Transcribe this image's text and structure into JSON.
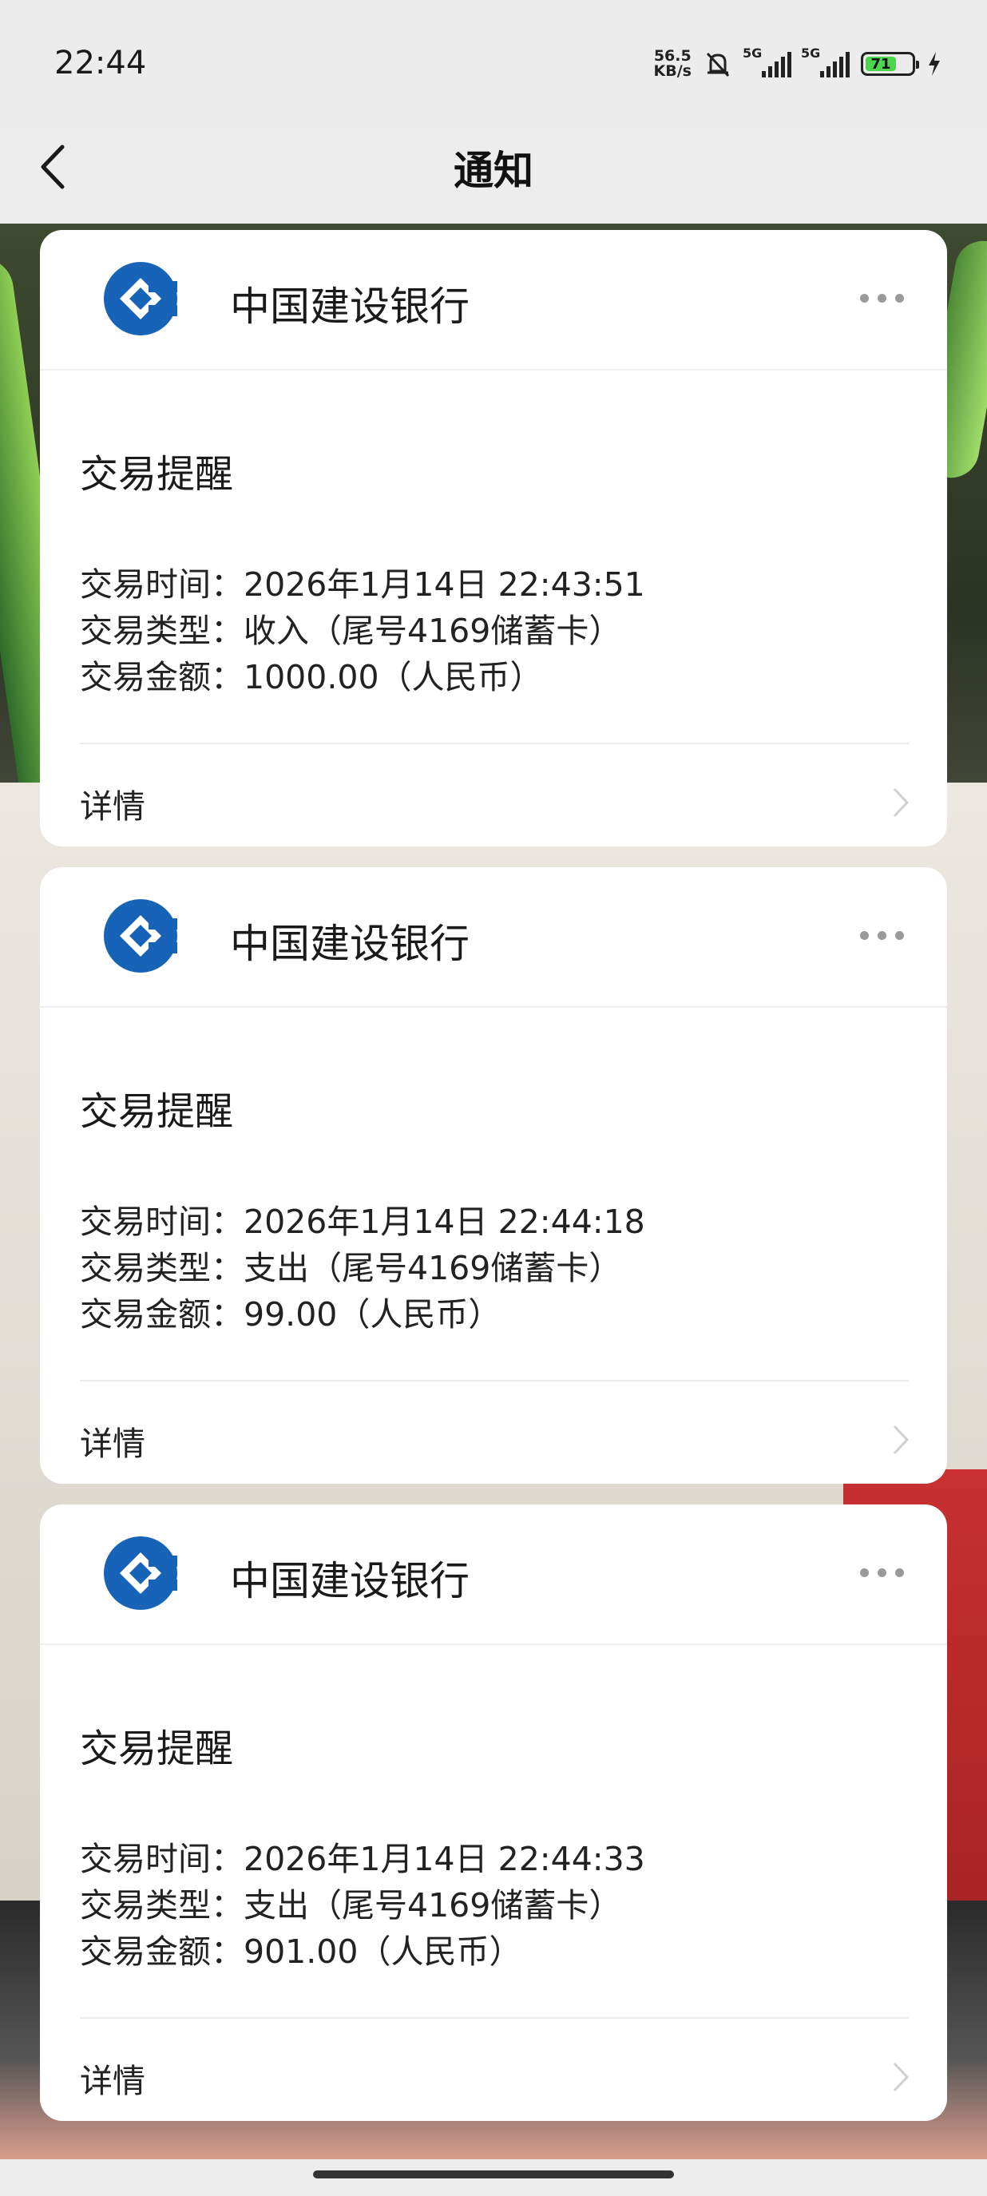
{
  "status_bar": {
    "time": "22:44",
    "net_speed": "56.5",
    "net_unit": "KB/s",
    "signal1_label": "5G",
    "signal2_label": "5G",
    "battery_level": "71",
    "icons": [
      "mute-bell-icon",
      "signal-icon",
      "battery-icon",
      "charging-icon"
    ]
  },
  "nav": {
    "title": "通知",
    "back_icon": "chevron-left-icon"
  },
  "notifications": [
    {
      "bank_name": "中国建设银行",
      "title": "交易提醒",
      "time_line": "交易时间：2026年1月14日 22:43:51",
      "type_line": "交易类型：收入（尾号4169储蓄卡）",
      "amount_line": "交易金额：1000.00（人民币）",
      "details_label": "详情"
    },
    {
      "bank_name": "中国建设银行",
      "title": "交易提醒",
      "time_line": "交易时间：2026年1月14日 22:44:18",
      "type_line": "交易类型：支出（尾号4169储蓄卡）",
      "amount_line": "交易金额：99.00（人民币）",
      "details_label": "详情"
    },
    {
      "bank_name": "中国建设银行",
      "title": "交易提醒",
      "time_line": "交易时间：2026年1月14日 22:44:33",
      "type_line": "交易类型：支出（尾号4169储蓄卡）",
      "amount_line": "交易金额：901.00（人民币）",
      "details_label": "详情"
    }
  ],
  "colors": {
    "bank_blue": "#1763b8",
    "card_bg": "#ffffff",
    "battery_green": "#4fd44f"
  }
}
